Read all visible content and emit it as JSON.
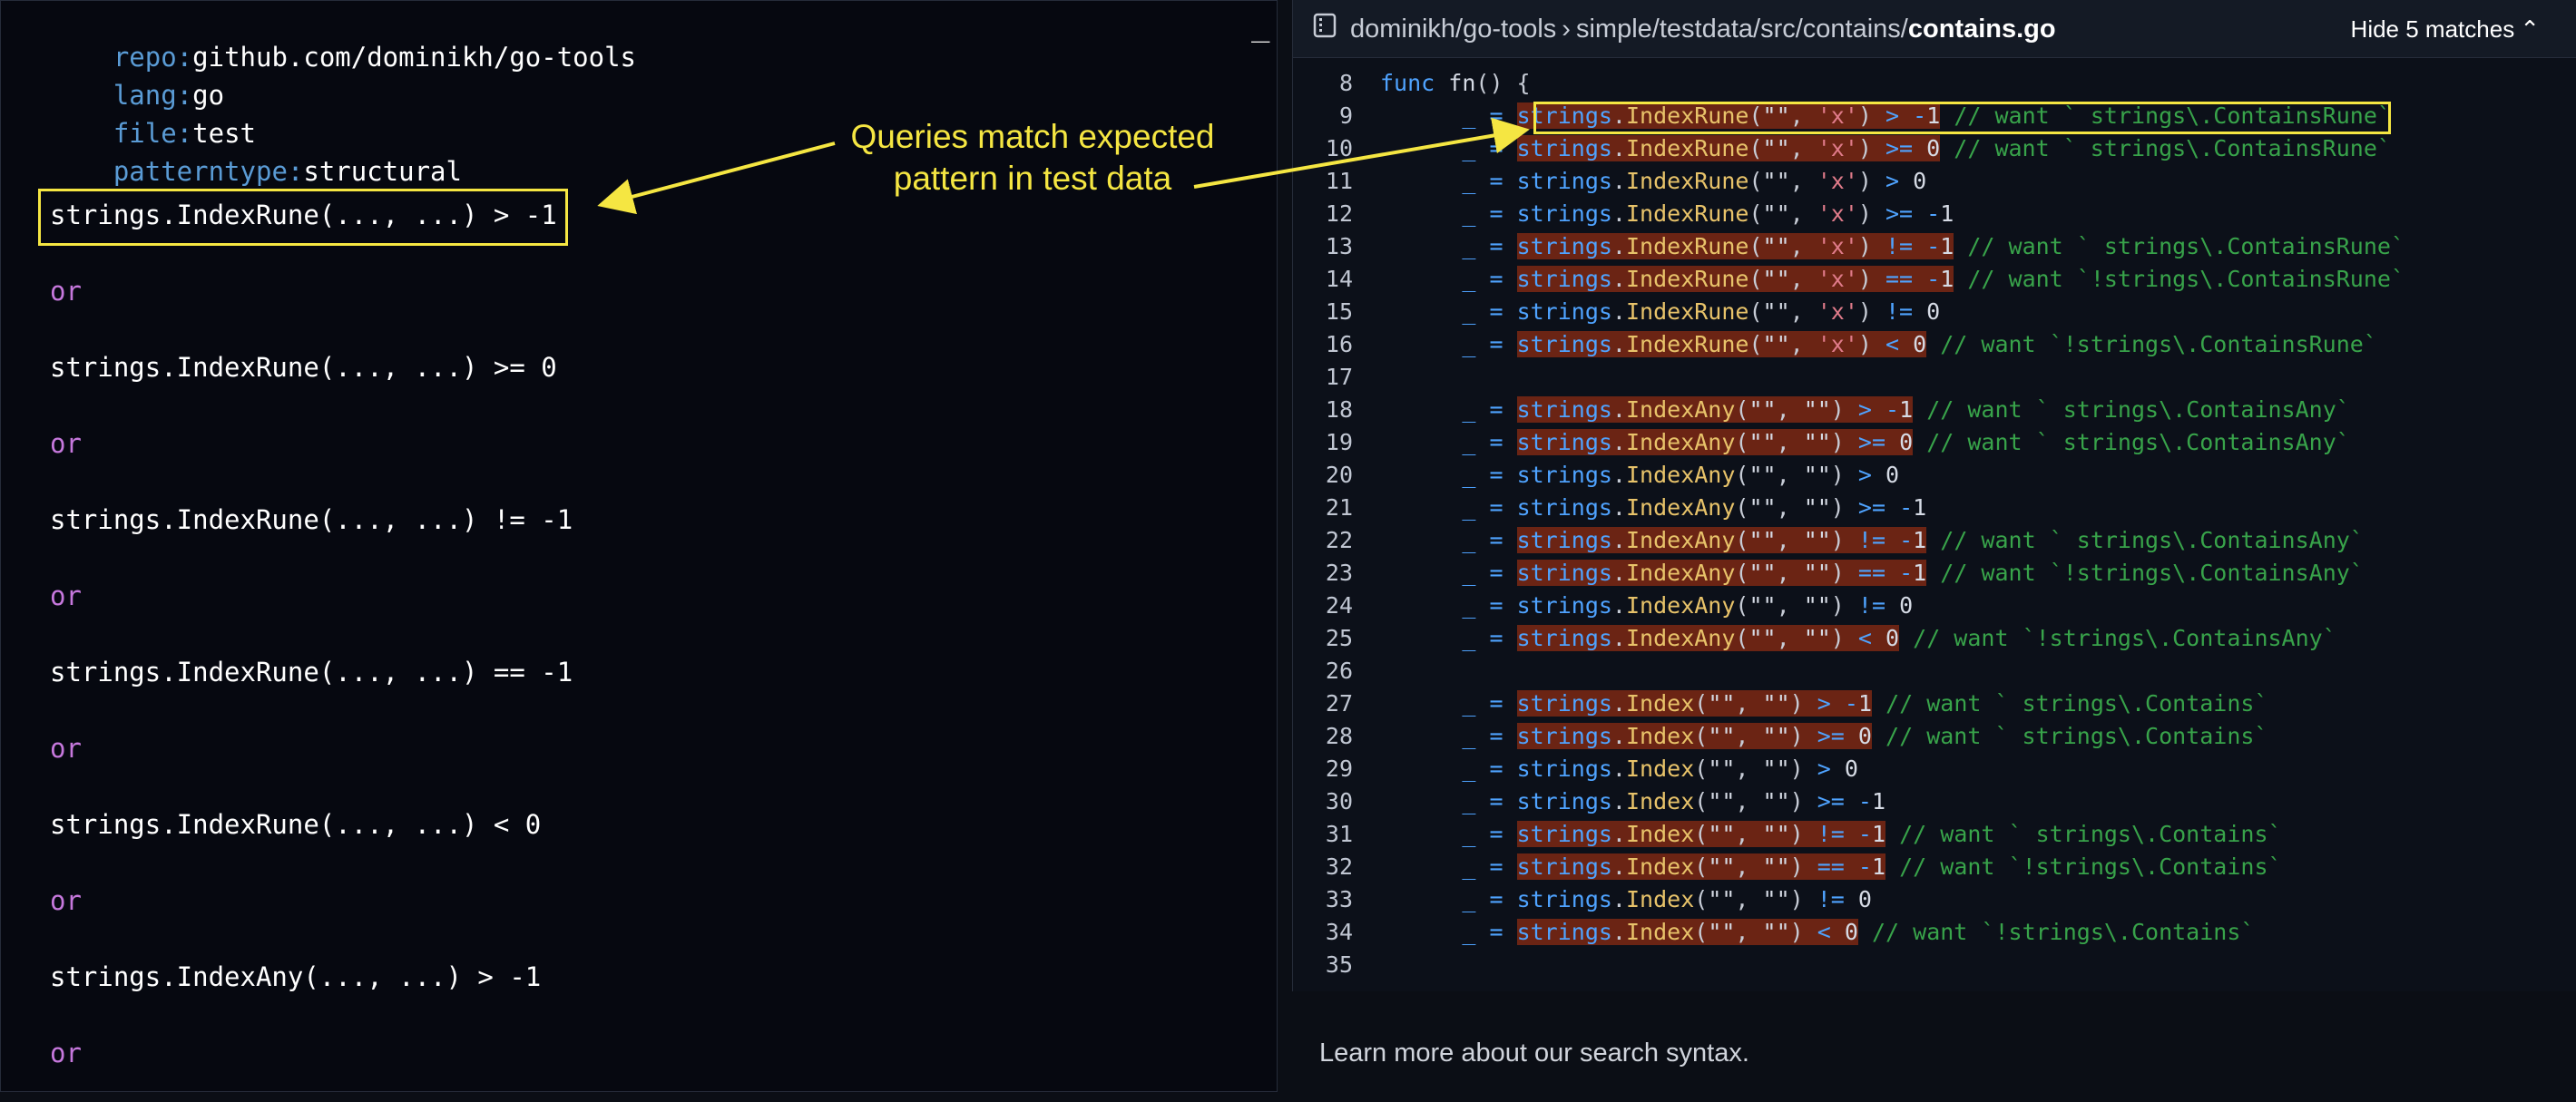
{
  "query": {
    "repo_key": "repo:",
    "repo_value": "github.com/dominikh/go-tools",
    "lang_key": "lang:",
    "lang_value": "go",
    "file_key": "file:",
    "file_value": "test",
    "pattern_key": "patterntype:",
    "pattern_value": "structural",
    "minimize_glyph": "_",
    "clauses": [
      "strings.IndexRune(..., ...) > -1",
      "strings.IndexRune(..., ...) >= 0",
      "strings.IndexRune(..., ...) != -1",
      "strings.IndexRune(..., ...) == -1",
      "strings.IndexRune(..., ...) < 0",
      "strings.IndexAny(..., ...) > -1"
    ],
    "or_label": "or"
  },
  "annotation": {
    "line1": "Queries match expected",
    "line2": "pattern in test data"
  },
  "viewer": {
    "repo": "dominikh/go-tools",
    "separator": "›",
    "path": "simple/testdata/src/contains/",
    "file": "contains.go",
    "hide_matches_label": "Hide 5 matches",
    "chevron": "⌃",
    "icon": "repo-icon"
  },
  "code": {
    "lines": [
      {
        "n": "8",
        "kind": "func",
        "text": "func fn() {"
      },
      {
        "n": "9",
        "kind": "call",
        "pkg": "strings",
        "fn": "IndexRune",
        "args": [
          "\"\"",
          "'x'"
        ],
        "op": ">",
        "val": "-1",
        "hl": true,
        "comment": "// want ` strings\\.ContainsRune`"
      },
      {
        "n": "10",
        "kind": "call",
        "pkg": "strings",
        "fn": "IndexRune",
        "args": [
          "\"\"",
          "'x'"
        ],
        "op": ">=",
        "val": "0",
        "hl": true,
        "comment": "// want ` strings\\.ContainsRune`"
      },
      {
        "n": "11",
        "kind": "call",
        "pkg": "strings",
        "fn": "IndexRune",
        "args": [
          "\"\"",
          "'x'"
        ],
        "op": ">",
        "val": "0",
        "hl": false,
        "comment": ""
      },
      {
        "n": "12",
        "kind": "call",
        "pkg": "strings",
        "fn": "IndexRune",
        "args": [
          "\"\"",
          "'x'"
        ],
        "op": ">=",
        "val": "-1",
        "hl": false,
        "comment": ""
      },
      {
        "n": "13",
        "kind": "call",
        "pkg": "strings",
        "fn": "IndexRune",
        "args": [
          "\"\"",
          "'x'"
        ],
        "op": "!=",
        "val": "-1",
        "hl": true,
        "comment": "// want ` strings\\.ContainsRune`"
      },
      {
        "n": "14",
        "kind": "call",
        "pkg": "strings",
        "fn": "IndexRune",
        "args": [
          "\"\"",
          "'x'"
        ],
        "op": "==",
        "val": "-1",
        "hl": true,
        "comment": "// want `!strings\\.ContainsRune`"
      },
      {
        "n": "15",
        "kind": "call",
        "pkg": "strings",
        "fn": "IndexRune",
        "args": [
          "\"\"",
          "'x'"
        ],
        "op": "!=",
        "val": "0",
        "hl": false,
        "comment": ""
      },
      {
        "n": "16",
        "kind": "call",
        "pkg": "strings",
        "fn": "IndexRune",
        "args": [
          "\"\"",
          "'x'"
        ],
        "op": "<",
        "val": "0",
        "hl": true,
        "comment": "// want `!strings\\.ContainsRune`"
      },
      {
        "n": "17",
        "kind": "blank",
        "text": ""
      },
      {
        "n": "18",
        "kind": "call",
        "pkg": "strings",
        "fn": "IndexAny",
        "args": [
          "\"\"",
          "\"\""
        ],
        "op": ">",
        "val": "-1",
        "hl": true,
        "comment": "// want ` strings\\.ContainsAny`"
      },
      {
        "n": "19",
        "kind": "call",
        "pkg": "strings",
        "fn": "IndexAny",
        "args": [
          "\"\"",
          "\"\""
        ],
        "op": ">=",
        "val": "0",
        "hl": true,
        "comment": "// want ` strings\\.ContainsAny`"
      },
      {
        "n": "20",
        "kind": "call",
        "pkg": "strings",
        "fn": "IndexAny",
        "args": [
          "\"\"",
          "\"\""
        ],
        "op": ">",
        "val": "0",
        "hl": false,
        "comment": ""
      },
      {
        "n": "21",
        "kind": "call",
        "pkg": "strings",
        "fn": "IndexAny",
        "args": [
          "\"\"",
          "\"\""
        ],
        "op": ">=",
        "val": "-1",
        "hl": false,
        "comment": ""
      },
      {
        "n": "22",
        "kind": "call",
        "pkg": "strings",
        "fn": "IndexAny",
        "args": [
          "\"\"",
          "\"\""
        ],
        "op": "!=",
        "val": "-1",
        "hl": true,
        "comment": "// want ` strings\\.ContainsAny`"
      },
      {
        "n": "23",
        "kind": "call",
        "pkg": "strings",
        "fn": "IndexAny",
        "args": [
          "\"\"",
          "\"\""
        ],
        "op": "==",
        "val": "-1",
        "hl": true,
        "comment": "// want `!strings\\.ContainsAny`"
      },
      {
        "n": "24",
        "kind": "call",
        "pkg": "strings",
        "fn": "IndexAny",
        "args": [
          "\"\"",
          "\"\""
        ],
        "op": "!=",
        "val": "0",
        "hl": false,
        "comment": ""
      },
      {
        "n": "25",
        "kind": "call",
        "pkg": "strings",
        "fn": "IndexAny",
        "args": [
          "\"\"",
          "\"\""
        ],
        "op": "<",
        "val": "0",
        "hl": true,
        "comment": "// want `!strings\\.ContainsAny`"
      },
      {
        "n": "26",
        "kind": "blank",
        "text": ""
      },
      {
        "n": "27",
        "kind": "call",
        "pkg": "strings",
        "fn": "Index",
        "args": [
          "\"\"",
          "\"\""
        ],
        "op": ">",
        "val": "-1",
        "hl": true,
        "comment": "// want ` strings\\.Contains`"
      },
      {
        "n": "28",
        "kind": "call",
        "pkg": "strings",
        "fn": "Index",
        "args": [
          "\"\"",
          "\"\""
        ],
        "op": ">=",
        "val": "0",
        "hl": true,
        "comment": "// want ` strings\\.Contains`"
      },
      {
        "n": "29",
        "kind": "call",
        "pkg": "strings",
        "fn": "Index",
        "args": [
          "\"\"",
          "\"\""
        ],
        "op": ">",
        "val": "0",
        "hl": false,
        "comment": ""
      },
      {
        "n": "30",
        "kind": "call",
        "pkg": "strings",
        "fn": "Index",
        "args": [
          "\"\"",
          "\"\""
        ],
        "op": ">=",
        "val": "-1",
        "hl": false,
        "comment": ""
      },
      {
        "n": "31",
        "kind": "call",
        "pkg": "strings",
        "fn": "Index",
        "args": [
          "\"\"",
          "\"\""
        ],
        "op": "!=",
        "val": "-1",
        "hl": true,
        "comment": "// want ` strings\\.Contains`"
      },
      {
        "n": "32",
        "kind": "call",
        "pkg": "strings",
        "fn": "Index",
        "args": [
          "\"\"",
          "\"\""
        ],
        "op": "==",
        "val": "-1",
        "hl": true,
        "comment": "// want `!strings\\.Contains`"
      },
      {
        "n": "33",
        "kind": "call",
        "pkg": "strings",
        "fn": "Index",
        "args": [
          "\"\"",
          "\"\""
        ],
        "op": "!=",
        "val": "0",
        "hl": false,
        "comment": ""
      },
      {
        "n": "34",
        "kind": "call",
        "pkg": "strings",
        "fn": "Index",
        "args": [
          "\"\"",
          "\"\""
        ],
        "op": "<",
        "val": "0",
        "hl": true,
        "comment": "// want `!strings\\.Contains`"
      },
      {
        "n": "35",
        "kind": "blank",
        "text": ""
      }
    ]
  },
  "footer": {
    "learn_more": "Learn more about our search syntax."
  },
  "colors": {
    "highlight_box": "#f5e642",
    "match_background": "#6b2414",
    "annotation": "#f5e642"
  }
}
